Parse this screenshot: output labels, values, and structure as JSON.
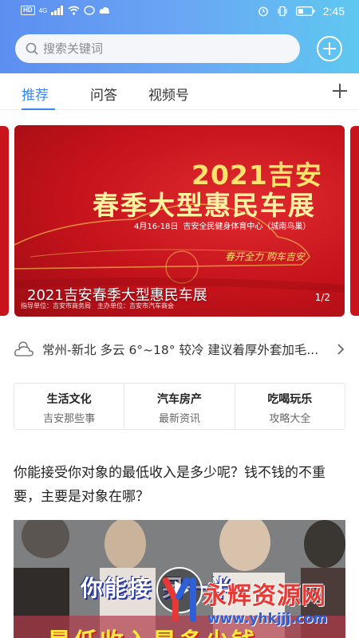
{
  "status_bar": {
    "hd_badge": "HD",
    "network": "4G",
    "battery_icon": "battery-icon",
    "time": "2:45"
  },
  "search": {
    "placeholder": "搜索关键词",
    "icon": "search-icon"
  },
  "tabs": [
    {
      "label": "推荐",
      "active": true
    },
    {
      "label": "问答",
      "active": false
    },
    {
      "label": "视频号",
      "active": false
    }
  ],
  "banner": {
    "title_line1": "2021吉安",
    "title_line2": "春季大型惠民车展",
    "date": "4月16-18日",
    "venue": "吉安全民健身体育中心（城南鸟巢）",
    "slogan": "春开全力 购车吉安",
    "caption": "2021吉安春季大型惠民车展",
    "footer_1": "指导单位：吉安市商务局",
    "footer_2": "主办单位：吉安市汽车商会",
    "page_indicator": "1/2",
    "accent_color": "#c4121b"
  },
  "weather": {
    "icon": "cloud-icon",
    "text": "常州-新北 多云 6°~18° 较冷 建议着厚外套加毛..."
  },
  "categories": [
    {
      "title": "生活文化",
      "subtitle": "吉安那些事"
    },
    {
      "title": "汽车房产",
      "subtitle": "最新资讯"
    },
    {
      "title": "吃喝玩乐",
      "subtitle": "攻略大全"
    }
  ],
  "article": {
    "title": "你能接受你对象的最低收入是多少呢？钱不钱的不重要，主要是对象在哪？",
    "image_text_line1": "你能接 另一半",
    "image_text_line2": "最低收入是多少钱"
  },
  "watermark": {
    "text": "永辉资源网",
    "url": "www.yhkjjj.com"
  }
}
